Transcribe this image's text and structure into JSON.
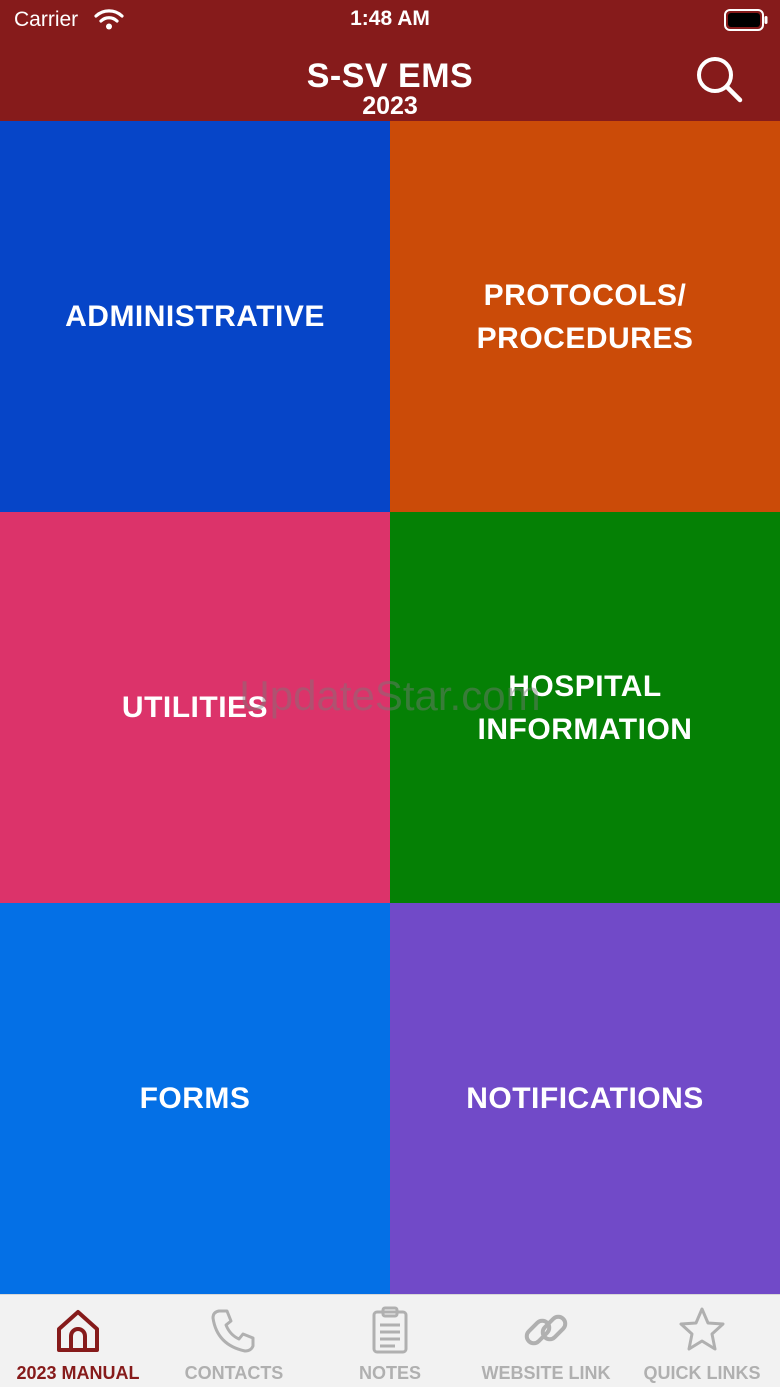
{
  "status_bar": {
    "carrier": "Carrier",
    "time": "1:48 AM"
  },
  "header": {
    "title": "S-SV EMS",
    "subtitle": "2023",
    "search_icon": "search-icon"
  },
  "tiles": [
    {
      "label": "ADMINISTRATIVE",
      "color": "#0645c8"
    },
    {
      "label": "PROTOCOLS/\nPROCEDURES",
      "color": "#cb4b08"
    },
    {
      "label": "UTILITIES",
      "color": "#dc336a"
    },
    {
      "label": "HOSPITAL\nINFORMATION",
      "color": "#058005"
    },
    {
      "label": "FORMS",
      "color": "#0470e6"
    },
    {
      "label": "NOTIFICATIONS",
      "color": "#714ac8"
    }
  ],
  "watermark": "UpdateStar.com",
  "tabs": [
    {
      "label": "2023 MANUAL",
      "icon": "home-icon",
      "active": true
    },
    {
      "label": "CONTACTS",
      "icon": "phone-icon",
      "active": false
    },
    {
      "label": "NOTES",
      "icon": "clipboard-icon",
      "active": false
    },
    {
      "label": "WEBSITE LINK",
      "icon": "link-icon",
      "active": false
    },
    {
      "label": "QUICK LINKS",
      "icon": "star-icon",
      "active": false
    }
  ],
  "colors": {
    "header": "#861b1b",
    "tab_active": "#861b1b",
    "tab_inactive": "#b0b0b0",
    "tabbar_bg": "#f2f2f2"
  }
}
